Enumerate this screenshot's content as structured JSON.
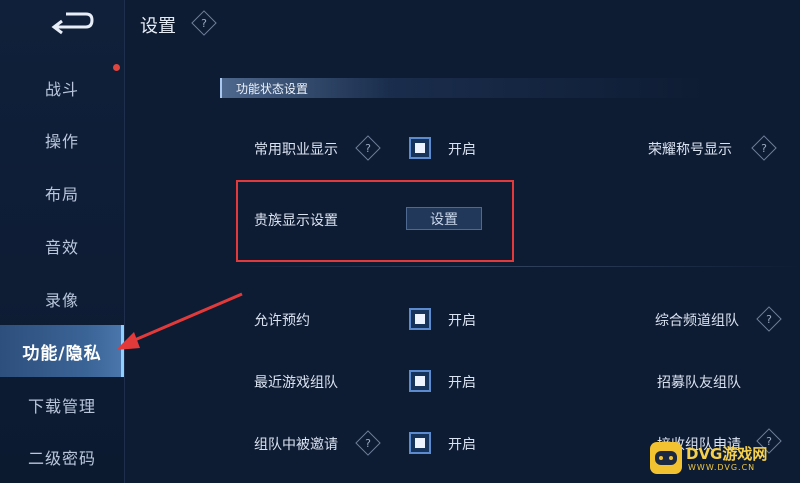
{
  "header": {
    "title": "设置"
  },
  "sidebar": {
    "items": [
      {
        "label": "战斗"
      },
      {
        "label": "操作"
      },
      {
        "label": "布局"
      },
      {
        "label": "音效"
      },
      {
        "label": "录像"
      },
      {
        "label": "功能/隐私",
        "active": true
      },
      {
        "label": "下载管理"
      },
      {
        "label": "二级密码"
      }
    ]
  },
  "section": {
    "title": "功能状态设置"
  },
  "settings": {
    "career_display": {
      "label": "常用职业显示",
      "state": "开启"
    },
    "honor_title": {
      "label": "荣耀称号显示"
    },
    "noble_display": {
      "label": "贵族显示设置",
      "button": "设置"
    },
    "allow_booking": {
      "label": "允许预约",
      "state": "开启"
    },
    "channel_team": {
      "label": "综合频道组队"
    },
    "recent_game_team": {
      "label": "最近游戏组队",
      "state": "开启"
    },
    "recruit_team": {
      "label": "招募队友组队"
    },
    "team_invite": {
      "label": "组队中被邀请",
      "state": "开启"
    },
    "team_request": {
      "label": "接收组队申请"
    }
  },
  "watermark": {
    "text": "DVG游戏网",
    "sub": "WWW.DVG.CN"
  },
  "colors": {
    "accent": "#5d8bd0",
    "highlight": "#e23a3a",
    "active_nav": "#3b6496"
  }
}
